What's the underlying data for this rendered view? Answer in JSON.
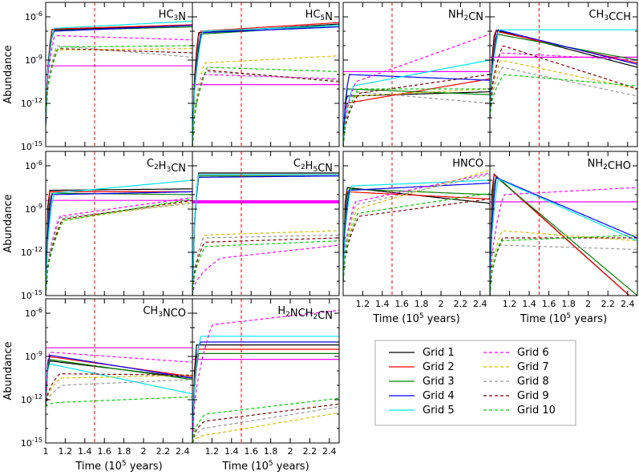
{
  "chart_data": {
    "type": "line",
    "ylabel": "Abundance",
    "xlabel_parts": [
      "Time (10",
      "5",
      " years)"
    ],
    "xlim": [
      1.0,
      2.5
    ],
    "ylim_exp": [
      -15,
      -5
    ],
    "y_scale": "log",
    "yticks": [
      {
        "base": "10",
        "exp": "-15"
      },
      {
        "base": "10",
        "exp": "-12"
      },
      {
        "base": "10",
        "exp": "-9"
      },
      {
        "base": "10",
        "exp": "-6"
      }
    ],
    "xticks_first": [
      "1",
      "1.2",
      "1.4",
      "1.6",
      "1.8",
      "2",
      "2.2",
      "2.4"
    ],
    "xticks_other": [
      "1.2",
      "1.4",
      "1.6",
      "1.8",
      "2",
      "2.2",
      "2.4"
    ],
    "marker_time": 1.5,
    "series": [
      {
        "name": "Grid 1",
        "color": "#000000",
        "dash": false
      },
      {
        "name": "Grid 2",
        "color": "#ff0000",
        "dash": false
      },
      {
        "name": "Grid 3",
        "color": "#008000",
        "dash": false
      },
      {
        "name": "Grid 4",
        "color": "#0000ff",
        "dash": false
      },
      {
        "name": "Grid 5",
        "color": "#00e5ee",
        "dash": false
      },
      {
        "name": "Grid 6",
        "color": "#ff00ff",
        "dash": true
      },
      {
        "name": "Grid 7",
        "color": "#d4c000",
        "dash": true
      },
      {
        "name": "Grid 8",
        "color": "#999999",
        "dash": true
      },
      {
        "name": "Grid 9",
        "color": "#800000",
        "dash": true
      },
      {
        "name": "Grid 10",
        "color": "#00cc00",
        "dash": true
      }
    ],
    "observed_color": "#ff00ff",
    "panels": [
      {
        "title": [
          "HC",
          {
            "sub": "3"
          },
          "N"
        ],
        "observed": -9.4,
        "curves": [
          [
            0.06,
            -13.5,
            -6.9,
            -6.6
          ],
          [
            0.065,
            -13.3,
            -6.85,
            -6.55
          ],
          [
            0.07,
            -13.6,
            -6.95,
            -6.7
          ],
          [
            0.075,
            -13.4,
            -7.0,
            -6.6
          ],
          [
            0.08,
            -13.2,
            -6.8,
            -6.3
          ],
          [
            0.09,
            -13.0,
            -7.3,
            -7.6
          ],
          [
            0.1,
            -13.0,
            -8.3,
            -8.2
          ],
          [
            0.11,
            -13.0,
            -8.0,
            -8.8
          ],
          [
            0.12,
            -13.0,
            -8.2,
            -8.5
          ],
          [
            0.13,
            -13.0,
            -8.1,
            -8.0
          ]
        ]
      },
      {
        "title": [
          "HC",
          {
            "sub": "5"
          },
          "N"
        ],
        "observed": -10.7,
        "curves": [
          [
            0.06,
            -15.0,
            -7.1,
            -6.5
          ],
          [
            0.07,
            -15.0,
            -7.0,
            -6.4
          ],
          [
            0.08,
            -15.0,
            -7.2,
            -6.6
          ],
          [
            0.09,
            -15.0,
            -7.1,
            -6.7
          ],
          [
            0.1,
            -15.0,
            -7.0,
            -6.6
          ],
          [
            0.11,
            -15.0,
            -10.0,
            -10.3
          ],
          [
            0.12,
            -15.0,
            -9.2,
            -8.7
          ],
          [
            0.13,
            -15.0,
            -9.8,
            -10.4
          ],
          [
            0.14,
            -15.0,
            -9.7,
            -10.5
          ],
          [
            0.15,
            -15.0,
            -9.5,
            -9.8
          ]
        ]
      },
      {
        "title": [
          "NH",
          {
            "sub": "2"
          },
          "CN"
        ],
        "observed": -9.8,
        "curves": [
          [
            0.03,
            -15.0,
            -11.5,
            -11.2
          ],
          [
            0.03,
            -15.0,
            -12.0,
            -10.3
          ],
          [
            0.04,
            -15.0,
            -11.0,
            -11.4
          ],
          [
            0.06,
            -15.0,
            -10.0,
            -10.4
          ],
          [
            0.1,
            -15.0,
            -10.8,
            -9.0
          ],
          [
            0.13,
            -15.0,
            -10.5,
            -7.2
          ],
          [
            0.12,
            -15.0,
            -11.5,
            -11.0
          ],
          [
            0.14,
            -15.0,
            -11.2,
            -12.0
          ],
          [
            0.16,
            -15.0,
            -11.3,
            -10.0
          ],
          [
            0.15,
            -15.0,
            -11.0,
            -11.0
          ]
        ]
      },
      {
        "title": [
          "CH",
          {
            "sub": "3"
          },
          "CCH"
        ],
        "observed": -8.8,
        "curves": [
          [
            0.05,
            -13.0,
            -6.9,
            -9.5
          ],
          [
            0.06,
            -13.0,
            -7.0,
            -9.2
          ],
          [
            0.07,
            -13.0,
            -7.2,
            -9.0
          ],
          [
            0.08,
            -13.0,
            -6.9,
            -9.3
          ],
          [
            0.09,
            -13.0,
            -6.9,
            -6.9
          ],
          [
            0.1,
            -13.0,
            -8.5,
            -9.0
          ],
          [
            0.11,
            -13.0,
            -9.0,
            -11.0
          ],
          [
            0.12,
            -13.0,
            -9.5,
            -11.5
          ],
          [
            0.13,
            -13.0,
            -8.0,
            -11.0
          ],
          [
            0.14,
            -13.0,
            -10.0,
            -10.8
          ]
        ]
      },
      {
        "title": [
          "C",
          {
            "sub": "2"
          },
          "H",
          {
            "sub": "3"
          },
          "CN"
        ],
        "observed": -8.4,
        "curves": [
          [
            0.03,
            -15.0,
            -7.7,
            -7.6
          ],
          [
            0.04,
            -15.0,
            -7.8,
            -7.8
          ],
          [
            0.05,
            -15.0,
            -7.9,
            -8.0
          ],
          [
            0.06,
            -15.0,
            -8.0,
            -7.8
          ],
          [
            0.08,
            -15.0,
            -7.9,
            -7.0
          ],
          [
            0.14,
            -15.0,
            -9.5,
            -8.2
          ],
          [
            0.16,
            -15.0,
            -9.8,
            -8.5
          ],
          [
            0.15,
            -15.0,
            -9.6,
            -8.6
          ],
          [
            0.17,
            -15.0,
            -9.7,
            -8.4
          ],
          [
            0.18,
            -15.0,
            -9.8,
            -8.3
          ]
        ]
      },
      {
        "title": [
          "C",
          {
            "sub": "2"
          },
          "H",
          {
            "sub": "5"
          },
          "CN"
        ],
        "observed": -8.5,
        "curves": [
          [
            0.06,
            -15.0,
            -6.5,
            -6.5
          ],
          [
            0.06,
            -15.0,
            -6.6,
            -6.6
          ],
          [
            0.06,
            -15.0,
            -6.7,
            -6.7
          ],
          [
            0.06,
            -15.0,
            -6.8,
            -6.7
          ],
          [
            0.06,
            -15.0,
            -6.6,
            -6.6
          ],
          [
            0.29,
            -15.0,
            -12.4,
            -11.5
          ],
          [
            0.12,
            -15.0,
            -10.8,
            -10.5
          ],
          [
            0.11,
            -15.0,
            -11.0,
            -10.8
          ],
          [
            0.12,
            -15.0,
            -11.3,
            -11.0
          ],
          [
            0.13,
            -15.0,
            -11.6,
            -11.2
          ]
        ]
      },
      {
        "title": [
          "HNCO"
        ],
        "observed": null,
        "curves": [
          [
            0.03,
            -14.0,
            -7.5,
            -8.6
          ],
          [
            0.04,
            -14.0,
            -7.8,
            -8.3
          ],
          [
            0.05,
            -14.0,
            -7.6,
            -8.0
          ],
          [
            0.06,
            -14.0,
            -7.7,
            -7.2
          ],
          [
            0.08,
            -14.0,
            -7.4,
            -7.0
          ],
          [
            0.12,
            -14.0,
            -8.5,
            -6.5
          ],
          [
            0.14,
            -14.0,
            -9.0,
            -6.3
          ],
          [
            0.13,
            -14.0,
            -8.7,
            -6.6
          ],
          [
            0.16,
            -14.0,
            -9.5,
            -8.3
          ],
          [
            0.15,
            -14.0,
            -9.3,
            -7.9
          ]
        ]
      },
      {
        "title": [
          "NH",
          {
            "sub": "2"
          },
          "CHO"
        ],
        "observed": -8.5,
        "curves": [
          [
            0.03,
            -15.0,
            -6.5,
            -15.5
          ],
          [
            0.04,
            -15.0,
            -6.6,
            -15.5
          ],
          [
            0.05,
            -15.0,
            -6.7,
            -15.0
          ],
          [
            0.06,
            -15.0,
            -6.8,
            -11.0
          ],
          [
            0.08,
            -15.0,
            -6.9,
            -11.2
          ],
          [
            0.14,
            -15.0,
            -8.0,
            -7.5
          ],
          [
            0.12,
            -15.0,
            -10.5,
            -11.2
          ],
          [
            0.1,
            -15.0,
            -11.5,
            -11.8
          ],
          [
            0.13,
            -15.0,
            -11.0,
            -11.0
          ],
          [
            0.11,
            -15.0,
            -11.2,
            -10.8
          ]
        ]
      },
      {
        "title": [
          "CH",
          {
            "sub": "3"
          },
          "NCO"
        ],
        "observed": -8.4,
        "curves": [
          [
            0.03,
            -12.5,
            -9.3,
            -10.5
          ],
          [
            0.03,
            -12.5,
            -9.0,
            -10.4
          ],
          [
            0.03,
            -12.5,
            -9.2,
            -10.6
          ],
          [
            0.03,
            -12.5,
            -8.9,
            -10.5
          ],
          [
            0.03,
            -12.5,
            -9.5,
            -11.6
          ],
          [
            0.03,
            -12.5,
            -8.7,
            -9.4
          ],
          [
            0.15,
            -12.5,
            -10.5,
            -10.3
          ],
          [
            0.17,
            -12.5,
            -11.0,
            -10.6
          ],
          [
            0.14,
            -12.5,
            -10.2,
            -10.3
          ],
          [
            0.1,
            -12.5,
            -12.2,
            -11.8
          ]
        ]
      },
      {
        "title": [
          "H",
          {
            "sub": "2"
          },
          "NCH",
          {
            "sub": "2"
          },
          "CN"
        ],
        "observed": -9.2,
        "curves": [
          [
            0.04,
            -15.0,
            -8.2,
            -8.2
          ],
          [
            0.05,
            -15.0,
            -8.5,
            -8.5
          ],
          [
            0.06,
            -15.0,
            -8.8,
            -8.8
          ],
          [
            0.07,
            -15.0,
            -8.0,
            -8.0
          ],
          [
            0.08,
            -15.0,
            -7.6,
            -7.6
          ],
          [
            0.2,
            -15.0,
            -6.8,
            -5.8
          ],
          [
            0.1,
            -15.0,
            -14.5,
            -12.9
          ],
          [
            0.11,
            -15.0,
            -14.0,
            -12.5
          ],
          [
            0.12,
            -15.0,
            -13.5,
            -12.3
          ],
          [
            0.13,
            -15.0,
            -13.0,
            -11.9
          ]
        ]
      }
    ],
    "legend_location": "lower-right",
    "legend_columns": 2
  }
}
